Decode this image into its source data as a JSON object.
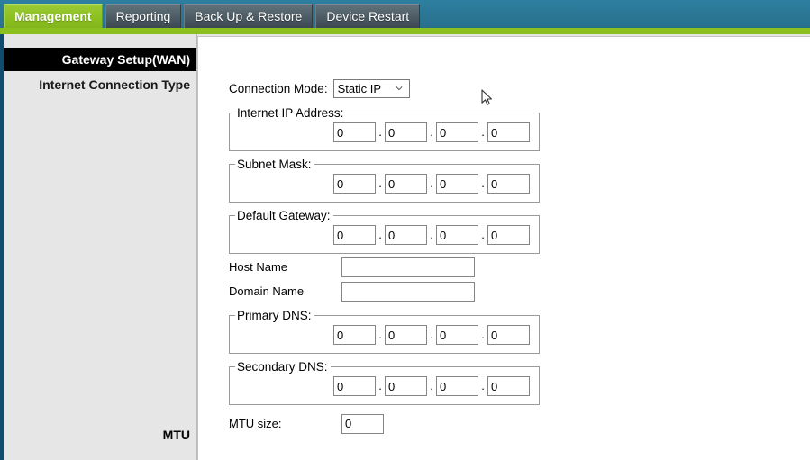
{
  "tabs": [
    {
      "label": "Management",
      "active": true
    },
    {
      "label": "Reporting",
      "active": false
    },
    {
      "label": "Back Up & Restore",
      "active": false
    },
    {
      "label": "Device Restart",
      "active": false
    }
  ],
  "sidebar": {
    "primary": "Gateway Setup(WAN)",
    "secondary": "Internet Connection Type",
    "mtu": "MTU"
  },
  "form": {
    "connection_mode_label": "Connection Mode:",
    "connection_mode_value": "Static IP",
    "connection_mode_options": [
      "Static IP"
    ],
    "internet_ip": {
      "legend": "Internet IP Address:",
      "octets": [
        "0",
        "0",
        "0",
        "0"
      ]
    },
    "subnet_mask": {
      "legend": "Subnet Mask:",
      "octets": [
        "0",
        "0",
        "0",
        "0"
      ]
    },
    "default_gateway": {
      "legend": "Default Gateway:",
      "octets": [
        "0",
        "0",
        "0",
        "0"
      ]
    },
    "host_name": {
      "label": "Host Name",
      "value": ""
    },
    "domain_name": {
      "label": "Domain Name",
      "value": ""
    },
    "primary_dns": {
      "legend": "Primary DNS:",
      "octets": [
        "0",
        "0",
        "0",
        "0"
      ]
    },
    "secondary_dns": {
      "legend": "Secondary DNS:",
      "octets": [
        "0",
        "0",
        "0",
        "0"
      ]
    },
    "mtu_size": {
      "label": "MTU size:",
      "value": "0"
    },
    "octet_separator": "."
  },
  "colors": {
    "header_teal": "#2a7693",
    "accent_green": "#8cc01f",
    "sidebar_bg": "#e6e6e6",
    "active_item_bg": "#000000"
  }
}
